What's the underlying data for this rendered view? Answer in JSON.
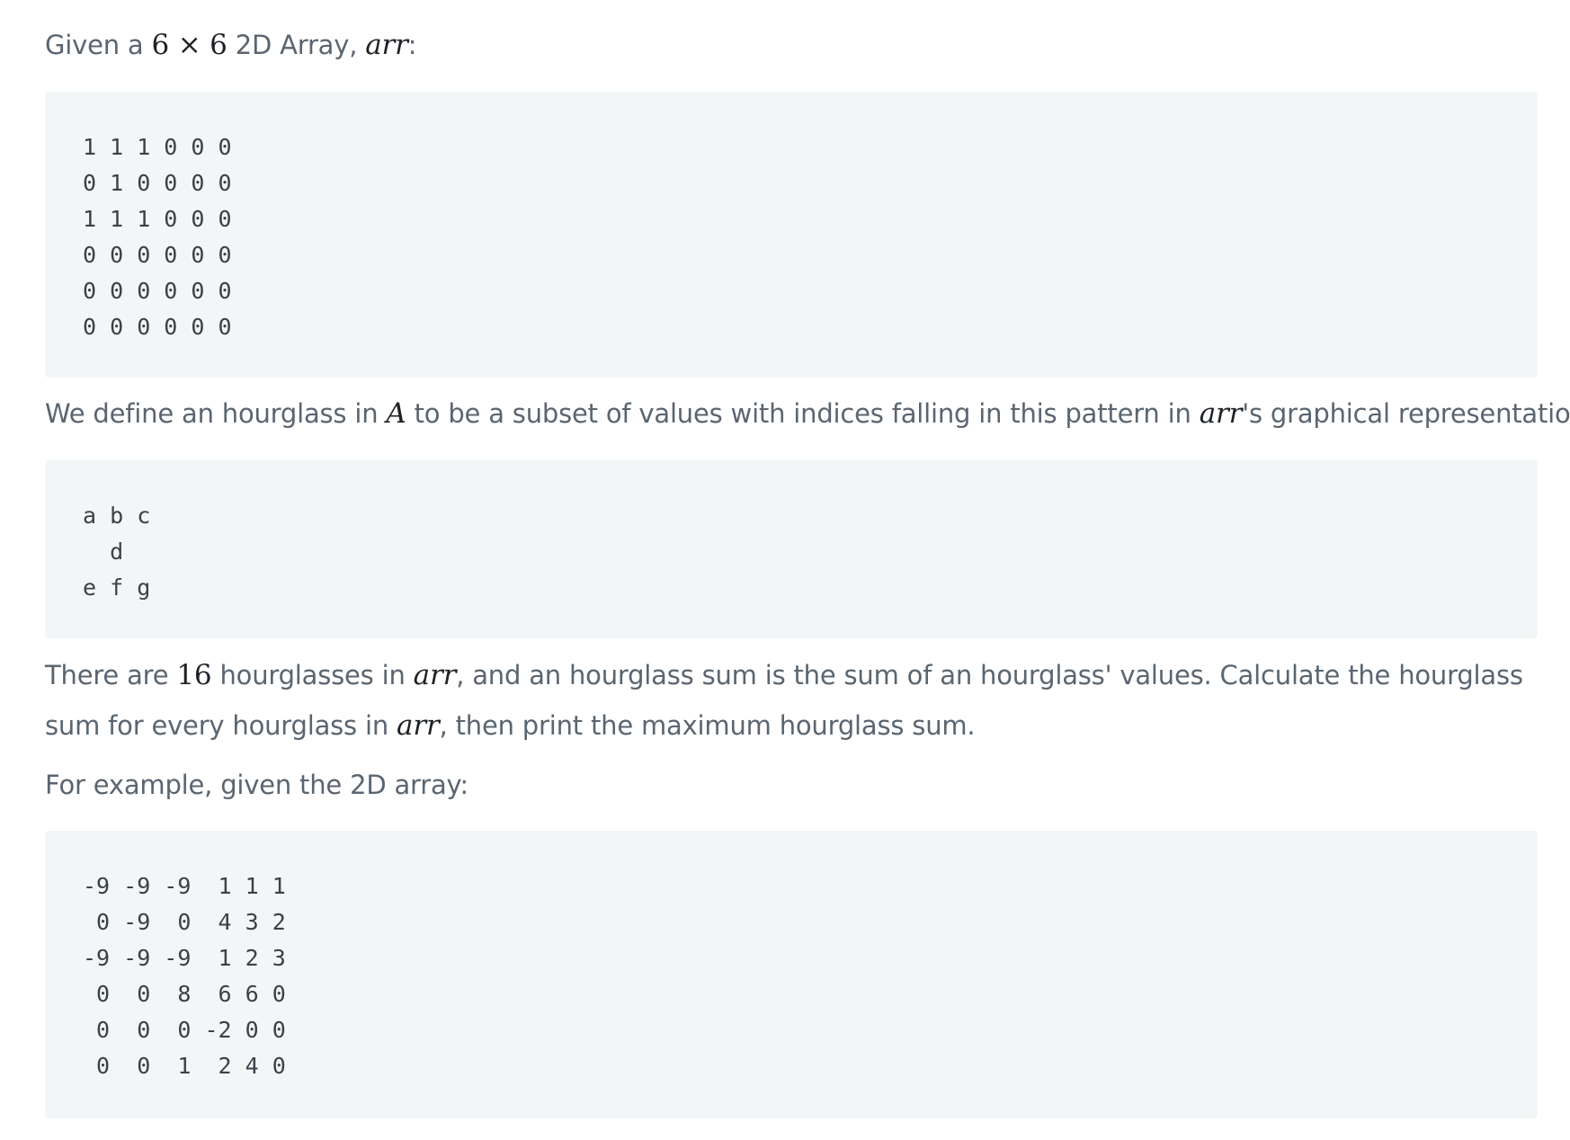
{
  "intro": {
    "prefix": "Given a ",
    "dim_a": "6",
    "times": " × ",
    "dim_b": "6",
    "suffix1": " 2D Array, ",
    "var": "arr",
    "suffix2": ":"
  },
  "array_block": "1 1 1 0 0 0\n0 1 0 0 0 0\n1 1 1 0 0 0\n0 0 0 0 0 0\n0 0 0 0 0 0\n0 0 0 0 0 0",
  "define": {
    "prefix": "We define an hourglass in ",
    "var_a": "A",
    "middle": " to be a subset of values with indices falling in this pattern in ",
    "var_arr": "arr",
    "suffix": "'s graphical representation:"
  },
  "pattern_block": "a b c\n  d\ne f g",
  "count": {
    "prefix": "There are ",
    "number": "16",
    "mid1": " hourglasses in ",
    "var1": "arr",
    "mid2": ", and an hourglass sum is the sum of an hourglass' values. Calculate the hourglass sum for every hourglass in ",
    "var2": "arr",
    "suffix": ", then print the maximum hourglass sum."
  },
  "example_intro": "For example, given the 2D array:",
  "example_block": "-9 -9 -9  1 1 1\n 0 -9  0  4 3 2\n-9 -9 -9  1 2 3\n 0  0  8  6 6 0\n 0  0  0 -2 0 0\n 0  0  1  2 4 0"
}
